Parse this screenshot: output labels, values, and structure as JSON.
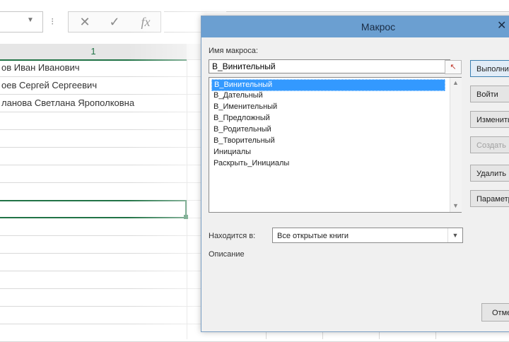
{
  "sheet": {
    "column_header": "1",
    "rows": [
      "ов Иван Иванович",
      "оев Сергей Сергеевич",
      "ланова Светлана Ярополковна",
      "",
      "",
      "",
      "",
      "",
      "",
      "",
      "",
      "",
      "",
      "",
      "",
      ""
    ]
  },
  "formula_bar": {
    "cancel_glyph": "✕",
    "enter_glyph": "✓",
    "function_glyph": "fx"
  },
  "dialog": {
    "title": "Макрос",
    "close_glyph": "✕",
    "macro_name_label": "Имя макроса:",
    "macro_name_value": "В_Винительный",
    "macros": [
      "В_Винительный",
      "В_Дательный",
      "В_Именительный",
      "В_Предложный",
      "В_Родительный",
      "В_Творительный",
      "Инициалы",
      "Раскрыть_Инициалы"
    ],
    "selected_index": 0,
    "buttons": [
      {
        "label": "Выполнить",
        "enabled": true,
        "default": true
      },
      {
        "label": "Войти",
        "enabled": true,
        "default": false
      },
      {
        "label": "Изменить",
        "enabled": true,
        "default": false
      },
      {
        "label": "Создать",
        "enabled": false,
        "default": false
      },
      {
        "label": "Удалить",
        "enabled": true,
        "default": false
      },
      {
        "label": "Параметры...",
        "enabled": true,
        "default": false
      }
    ],
    "location_label": "Находится в:",
    "location_value": "Все открытые книги",
    "description_label": "Описание",
    "cancel_label": "Отмена"
  }
}
